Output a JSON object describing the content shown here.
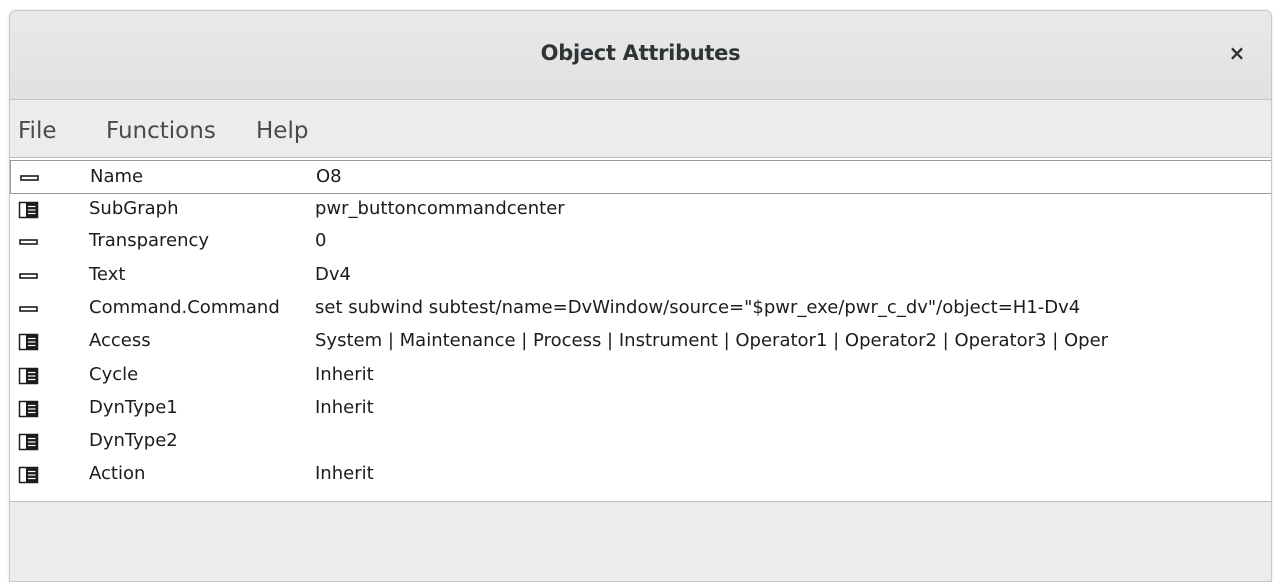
{
  "window": {
    "title": "Object Attributes",
    "close_label": "×"
  },
  "menu": {
    "items": [
      {
        "label": "File"
      },
      {
        "label": "Functions"
      },
      {
        "label": "Help"
      }
    ]
  },
  "attributes": [
    {
      "icon": "value-icon",
      "name": "Name",
      "value": "O8",
      "selected": true
    },
    {
      "icon": "folder-icon",
      "name": "SubGraph",
      "value": "pwr_buttoncommandcenter"
    },
    {
      "icon": "value-icon",
      "name": "Transparency",
      "value": "0"
    },
    {
      "icon": "value-icon",
      "name": "Text",
      "value": "Dv4"
    },
    {
      "icon": "value-icon",
      "name": "Command.Command",
      "value": " set subwind subtest/name=DvWindow/source=\"$pwr_exe/pwr_c_dv\"/object=H1-Dv4"
    },
    {
      "icon": "folder-icon",
      "name": "Access",
      "value": "System | Maintenance | Process | Instrument | Operator1 | Operator2 | Operator3 | Oper"
    },
    {
      "icon": "folder-icon",
      "name": "Cycle",
      "value": "Inherit"
    },
    {
      "icon": "folder-icon",
      "name": "DynType1",
      "value": "Inherit"
    },
    {
      "icon": "folder-icon",
      "name": "DynType2",
      "value": ""
    },
    {
      "icon": "folder-icon",
      "name": "Action",
      "value": "Inherit"
    }
  ]
}
